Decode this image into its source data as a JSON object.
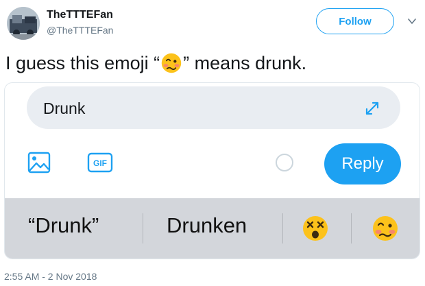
{
  "author": {
    "display_name": "TheTTTEFan",
    "handle": "@TheTTTEFan",
    "follow_label": "Follow",
    "avatar_icon": "tank-engine-avatar"
  },
  "tweet": {
    "text_before": "I guess this emoji “",
    "emoji_icon": "woozy-face-emoji",
    "text_after": "” means drunk.",
    "timestamp": "2:55 AM - 2 Nov 2018"
  },
  "composer": {
    "input_value": "Drunk",
    "reply_label": "Reply",
    "gif_label": "GIF"
  },
  "suggestions": {
    "items": [
      "“Drunk”",
      "Drunken"
    ],
    "emoji_icons": [
      "dizzy-face-emoji",
      "woozy-face-emoji"
    ]
  },
  "colors": {
    "accent": "#1da1f2",
    "muted_text": "#657786",
    "suggestion_bar": "#d3d6db",
    "composer_bg": "#e9edf2"
  }
}
